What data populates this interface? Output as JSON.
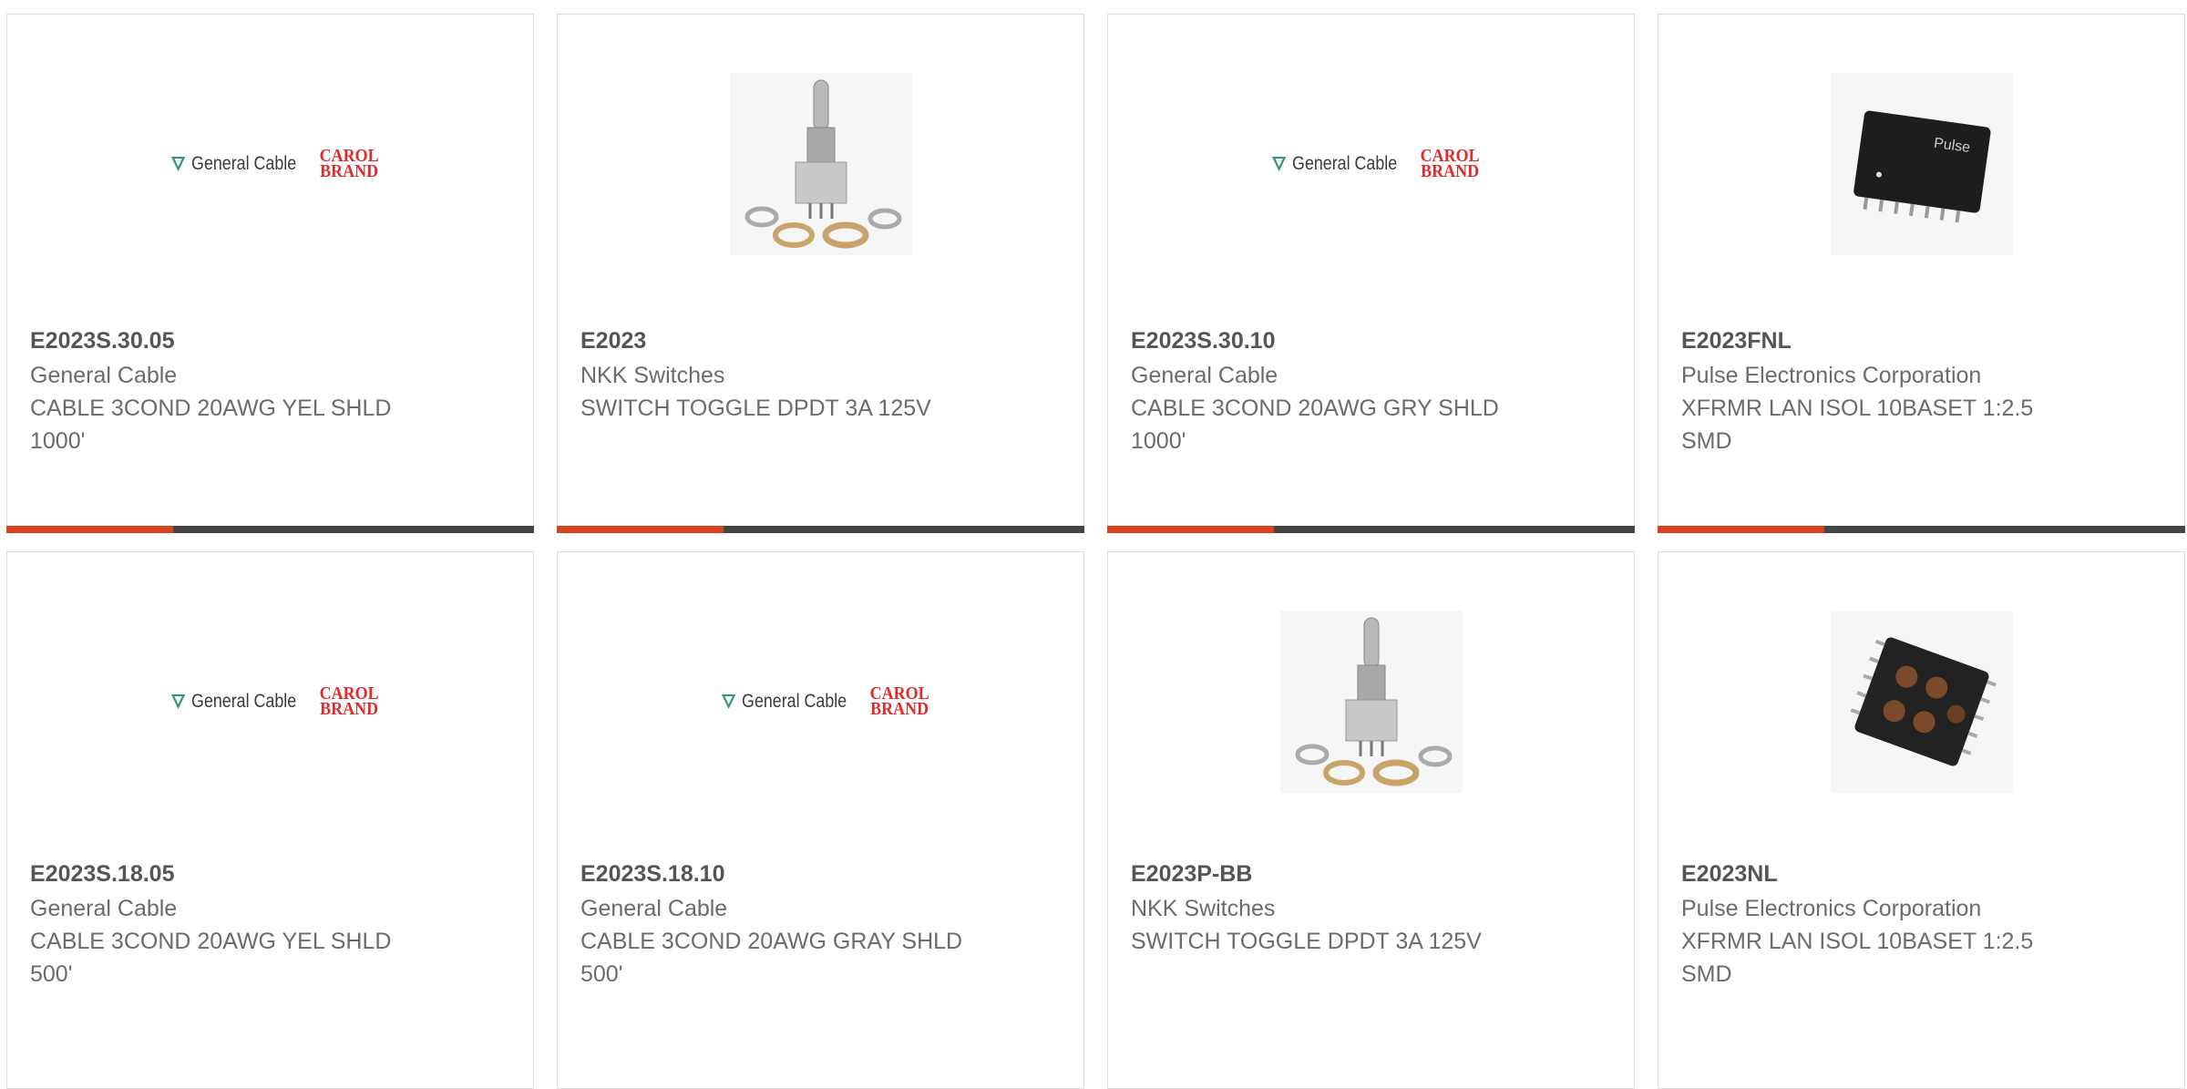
{
  "logo_text": {
    "general_cable": "General Cable",
    "carol": "CAROL",
    "brand": "BRAND",
    "pulse": "Pulse"
  },
  "cards": [
    {
      "part": "E2023S.30.05",
      "mfr": "General Cable",
      "desc": "CABLE 3COND 20AWG YEL SHLD 1000'",
      "image": "general-cable-carol-logo"
    },
    {
      "part": "E2023",
      "mfr": "NKK Switches",
      "desc": "SWITCH TOGGLE DPDT 3A 125V",
      "image": "toggle-switch-photo"
    },
    {
      "part": "E2023S.30.10",
      "mfr": "General Cable",
      "desc": "CABLE 3COND 20AWG GRY SHLD 1000'",
      "image": "general-cable-carol-logo"
    },
    {
      "part": "E2023FNL",
      "mfr": "Pulse Electronics Corporation",
      "desc": "XFRMR LAN ISOL 10BASET 1:2.5 SMD",
      "image": "transformer-photo"
    },
    {
      "part": "E2023S.18.05",
      "mfr": "General Cable",
      "desc": "CABLE 3COND 20AWG YEL SHLD 500'",
      "image": "general-cable-carol-logo"
    },
    {
      "part": "E2023S.18.10",
      "mfr": "General Cable",
      "desc": "CABLE 3COND 20AWG GRAY SHLD 500'",
      "image": "general-cable-carol-logo"
    },
    {
      "part": "E2023P-BB",
      "mfr": "NKK Switches",
      "desc": "SWITCH TOGGLE DPDT 3A 125V",
      "image": "toggle-switch-photo"
    },
    {
      "part": "E2023NL",
      "mfr": "Pulse Electronics Corporation",
      "desc": "XFRMR LAN ISOL 10BASET 1:2.5 SMD",
      "image": "transformer-open-photo"
    }
  ],
  "colors": {
    "accent": "#d9421b",
    "bar": "#444444",
    "brand_red": "#e02b2b"
  }
}
